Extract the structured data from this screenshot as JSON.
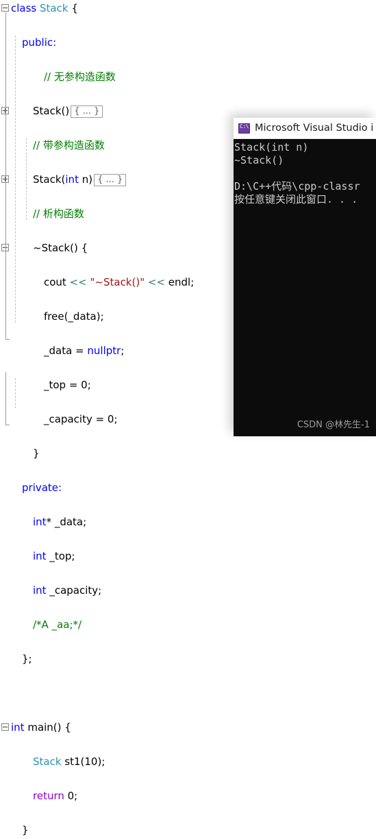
{
  "editor": {
    "lines": [
      {
        "id": "class-decl",
        "indent": 0,
        "glyph": "minus",
        "tokens": [
          {
            "t": "class",
            "c": "kw"
          },
          {
            "t": " ",
            "c": "plain"
          },
          {
            "t": "Stack",
            "c": "type"
          },
          {
            "t": " {",
            "c": "plain"
          }
        ]
      },
      {
        "id": "public-label",
        "indent": 1,
        "glyph": "none",
        "tokens": [
          {
            "t": "public:",
            "c": "kw"
          }
        ]
      },
      {
        "id": "comment-default-ctor",
        "indent": 3,
        "glyph": "none",
        "tokens": [
          {
            "t": "// 无参构造函数",
            "c": "cmt"
          }
        ]
      },
      {
        "id": "default-ctor",
        "indent": 2,
        "glyph": "plus",
        "tokens": [
          {
            "t": "Stack()",
            "c": "plain"
          },
          {
            "t": "{ ... }",
            "c": "collapsed"
          }
        ]
      },
      {
        "id": "comment-param-ctor",
        "indent": 2,
        "glyph": "none",
        "tokens": [
          {
            "t": "// 带参构造函数",
            "c": "cmt"
          }
        ]
      },
      {
        "id": "param-ctor",
        "indent": 2,
        "glyph": "plus",
        "tokens": [
          {
            "t": "Stack(",
            "c": "plain"
          },
          {
            "t": "int",
            "c": "kw"
          },
          {
            "t": " n)",
            "c": "plain"
          },
          {
            "t": "{ ... }",
            "c": "collapsed"
          }
        ]
      },
      {
        "id": "comment-dtor",
        "indent": 2,
        "glyph": "none",
        "tokens": [
          {
            "t": "// 析构函数",
            "c": "cmt"
          }
        ]
      },
      {
        "id": "dtor-open",
        "indent": 2,
        "glyph": "minus",
        "tokens": [
          {
            "t": "~Stack() {",
            "c": "plain"
          }
        ]
      },
      {
        "id": "cout-stmt",
        "indent": 3,
        "glyph": "none",
        "tokens": [
          {
            "t": "cout ",
            "c": "plain"
          },
          {
            "t": "<< ",
            "c": "op"
          },
          {
            "t": "\"~Stack()\"",
            "c": "str"
          },
          {
            "t": " << ",
            "c": "op"
          },
          {
            "t": "endl;",
            "c": "plain"
          }
        ]
      },
      {
        "id": "free-stmt",
        "indent": 3,
        "glyph": "none",
        "tokens": [
          {
            "t": "free(_data);",
            "c": "plain"
          }
        ]
      },
      {
        "id": "data-null-stmt",
        "indent": 3,
        "glyph": "none",
        "tokens": [
          {
            "t": "_data = ",
            "c": "plain"
          },
          {
            "t": "nullptr",
            "c": "kw"
          },
          {
            "t": ";",
            "c": "plain"
          }
        ]
      },
      {
        "id": "top-zero-stmt",
        "indent": 3,
        "glyph": "none",
        "tokens": [
          {
            "t": "_top = 0;",
            "c": "plain"
          }
        ]
      },
      {
        "id": "capacity-zero-stmt",
        "indent": 3,
        "glyph": "none",
        "tokens": [
          {
            "t": "_capacity = 0;",
            "c": "plain"
          }
        ]
      },
      {
        "id": "dtor-close",
        "indent": 2,
        "glyph": "none",
        "tokens": [
          {
            "t": "}",
            "c": "plain"
          }
        ]
      },
      {
        "id": "private-label",
        "indent": 1,
        "glyph": "none",
        "tokens": [
          {
            "t": "private:",
            "c": "kw"
          }
        ]
      },
      {
        "id": "member-data",
        "indent": 2,
        "glyph": "none",
        "tokens": [
          {
            "t": "int",
            "c": "kw"
          },
          {
            "t": "* _data;",
            "c": "plain"
          }
        ]
      },
      {
        "id": "member-top",
        "indent": 2,
        "glyph": "none",
        "tokens": [
          {
            "t": "int",
            "c": "kw"
          },
          {
            "t": " _top;",
            "c": "plain"
          }
        ]
      },
      {
        "id": "member-capacity",
        "indent": 2,
        "glyph": "none",
        "tokens": [
          {
            "t": "int",
            "c": "kw"
          },
          {
            "t": " _capacity;",
            "c": "plain"
          }
        ]
      },
      {
        "id": "member-commented",
        "indent": 2,
        "glyph": "none",
        "tokens": [
          {
            "t": "/*A _aa;*/",
            "c": "cmt"
          }
        ]
      },
      {
        "id": "class-close",
        "indent": 1,
        "glyph": "none",
        "tokens": [
          {
            "t": "};",
            "c": "plain"
          }
        ]
      },
      {
        "id": "blank-1",
        "indent": 0,
        "glyph": "none",
        "tokens": []
      },
      {
        "id": "main-open",
        "indent": 0,
        "glyph": "minus",
        "tokens": [
          {
            "t": "int",
            "c": "kw"
          },
          {
            "t": " main() {",
            "c": "plain"
          }
        ]
      },
      {
        "id": "stack-var-decl",
        "indent": 2,
        "glyph": "none",
        "tokens": [
          {
            "t": "Stack",
            "c": "type"
          },
          {
            "t": " st1(10);",
            "c": "plain"
          }
        ]
      },
      {
        "id": "return-stmt",
        "indent": 2,
        "glyph": "none",
        "tokens": [
          {
            "t": "return",
            "c": "ctrl"
          },
          {
            "t": " 0;",
            "c": "plain"
          }
        ]
      },
      {
        "id": "main-close",
        "indent": 1,
        "glyph": "none",
        "tokens": [
          {
            "t": "}",
            "c": "plain"
          }
        ]
      }
    ],
    "colors": {
      "keyword": "#0000FF",
      "type": "#2B91AF",
      "comment": "#008000",
      "string": "#A31515",
      "operator": "#3A7A7A",
      "control": "#8F08C4",
      "background": "#FFFFFF"
    }
  },
  "console": {
    "title": "Microsoft Visual Studio i",
    "icon": "console-window-icon",
    "background": "#0C0C0C",
    "foreground": "#CCCCCC",
    "lines": [
      "Stack(int n)",
      "~Stack()",
      "",
      "D:\\C++代码\\cpp-classr",
      "按任意键关闭此窗口. . ."
    ]
  },
  "watermark": {
    "text": "CSDN @林先生-1"
  }
}
